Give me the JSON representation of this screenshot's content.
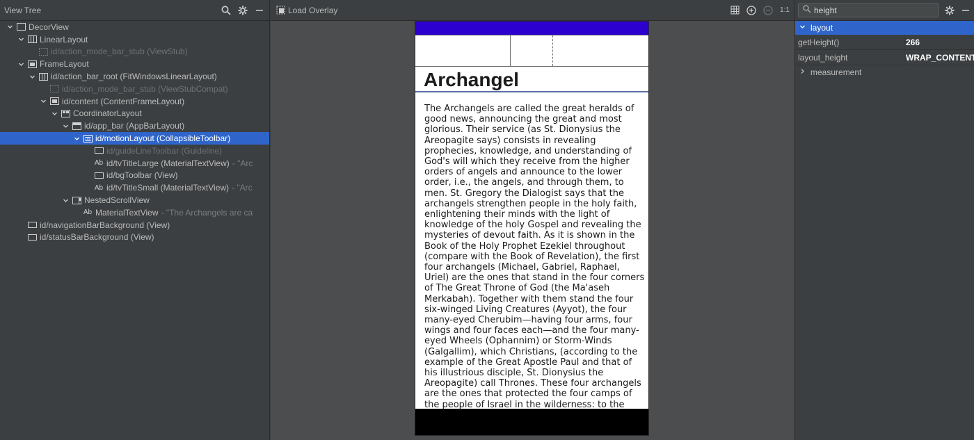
{
  "left_panel": {
    "title": "View Tree",
    "tree": [
      {
        "label": "DecorView",
        "suffix": "",
        "depth": 0,
        "arrow": "down",
        "icon": "frame",
        "dim": false,
        "selected": false
      },
      {
        "label": "LinearLayout",
        "suffix": "",
        "depth": 1,
        "arrow": "down",
        "icon": "columns",
        "dim": false,
        "selected": false
      },
      {
        "label": "id/action_mode_bar_stub (ViewStub)",
        "suffix": "",
        "depth": 2,
        "arrow": "none",
        "icon": "dotted",
        "dim": true,
        "selected": false
      },
      {
        "label": "FrameLayout",
        "suffix": "",
        "depth": 1,
        "arrow": "down",
        "icon": "frame-filled",
        "dim": false,
        "selected": false
      },
      {
        "label": "id/action_bar_root (FitWindowsLinearLayout)",
        "suffix": "",
        "depth": 2,
        "arrow": "down",
        "icon": "columns",
        "dim": false,
        "selected": false
      },
      {
        "label": "id/action_mode_bar_stub (ViewStubCompat)",
        "suffix": "",
        "depth": 3,
        "arrow": "none",
        "icon": "dotted",
        "dim": true,
        "selected": false
      },
      {
        "label": "id/content (ContentFrameLayout)",
        "suffix": "",
        "depth": 3,
        "arrow": "down",
        "icon": "frame-filled",
        "dim": false,
        "selected": false
      },
      {
        "label": "CoordinatorLayout",
        "suffix": "",
        "depth": 4,
        "arrow": "down",
        "icon": "coordinator",
        "dim": false,
        "selected": false
      },
      {
        "label": "id/app_bar (AppBarLayout)",
        "suffix": "",
        "depth": 5,
        "arrow": "down",
        "icon": "appbar",
        "dim": false,
        "selected": false
      },
      {
        "label": "id/motionLayout (CollapsibleToolbar)",
        "suffix": "",
        "depth": 6,
        "arrow": "down",
        "icon": "motion",
        "dim": false,
        "selected": true
      },
      {
        "label": "id/guideLineToolbar (Guideline)",
        "suffix": "",
        "depth": 7,
        "arrow": "none",
        "icon": "view",
        "dim": true,
        "selected": false
      },
      {
        "label": "id/tvTitleLarge (MaterialTextView)",
        "suffix": "- \"Arc",
        "depth": 7,
        "arrow": "none",
        "icon": "text",
        "dim": false,
        "selected": false
      },
      {
        "label": "id/bgToolbar (View)",
        "suffix": "",
        "depth": 7,
        "arrow": "none",
        "icon": "view",
        "dim": false,
        "selected": false
      },
      {
        "label": "id/tvTitleSmall (MaterialTextView)",
        "suffix": "- \"Arc",
        "depth": 7,
        "arrow": "none",
        "icon": "text",
        "dim": false,
        "selected": false
      },
      {
        "label": "NestedScrollView",
        "suffix": "",
        "depth": 5,
        "arrow": "down",
        "icon": "scroll",
        "dim": false,
        "selected": false
      },
      {
        "label": "MaterialTextView",
        "suffix": "- \"The Archangels are ca",
        "depth": 6,
        "arrow": "none",
        "icon": "text",
        "dim": false,
        "selected": false
      },
      {
        "label": "id/navigationBarBackground (View)",
        "suffix": "",
        "depth": 1,
        "arrow": "none",
        "icon": "view",
        "dim": false,
        "selected": false
      },
      {
        "label": "id/statusBarBackground (View)",
        "suffix": "",
        "depth": 1,
        "arrow": "none",
        "icon": "view",
        "dim": false,
        "selected": false
      }
    ]
  },
  "center_panel": {
    "load_overlay": "Load Overlay",
    "zoom_label": "1:1",
    "title_large": "Archangel",
    "article_text": "The Archangels are called the great heralds of good news, announcing the great and most glorious. Their service (as St. Dionysius the Areopagite says) consists in revealing prophecies, knowledge, and understanding of God's will which they receive from the higher orders of angels and announce to the lower order, i.e., the angels, and through them, to men. St. Gregory the Dialogist says that the archangels strengthen people in the holy faith, enlightening their minds with the light of knowledge of the holy Gospel and revealing the mysteries of devout faith. As it is shown in the Book of the Holy Prophet Ezekiel throughout (compare with the Book of Revelation), the first four archangels (Michael, Gabriel, Raphael, Uriel) are the ones that stand in the four corners of The Great Throne of God (the Ma'aseh Merkabah). Together with them stand the four six-winged Living Creatures (Ayyot), the four many-eyed Cherubim—having four arms, four wings and four faces each—and the four many-eyed Wheels (Ophannim) or Storm-Winds (Galgallim), which Christians, (according to the example of the Great Apostle Paul and that of his illustrious disciple, St. Dionysius the Areopagite) call Thrones. These four archangels are the ones that protected the four camps of the people of Israel in the wilderness: to the North, to the South, to the East and to the West. They are the angels of the four"
  },
  "right_panel": {
    "search_value": "height",
    "selected_group": "layout",
    "properties": [
      {
        "key": "getHeight()",
        "value": "266"
      },
      {
        "key": "layout_height",
        "value": "WRAP_CONTENT"
      }
    ],
    "collapsed_group": "measurement"
  },
  "colors": {
    "statusbar": "#2c00ce",
    "selection": "#2f65ca"
  }
}
